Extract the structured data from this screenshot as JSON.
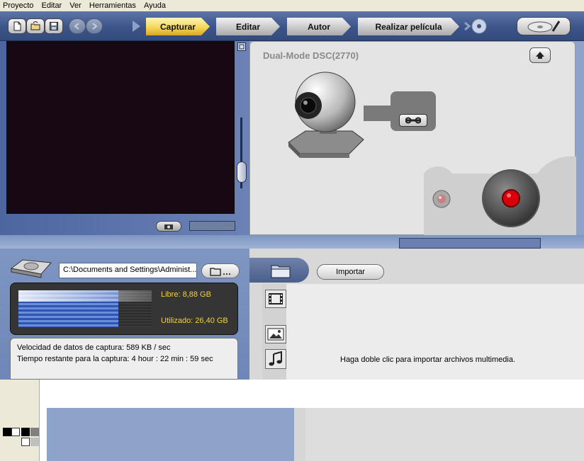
{
  "menu": [
    "Proyecto",
    "Editar",
    "Ver",
    "Herramientas",
    "Ayuda"
  ],
  "toolbar": {
    "file_icons": [
      "new-project-icon",
      "open-project-icon",
      "save-project-icon"
    ],
    "nav_icons": [
      "back-arrow-icon",
      "forward-arrow-icon"
    ],
    "steps": [
      "Capturar",
      "Editar",
      "Autor",
      "Realizar película"
    ],
    "active_step": "Capturar"
  },
  "device": {
    "name": "Dual-Mode DSC(2770)",
    "up_icon": "up-arrow-icon",
    "settings_icon": "wrench-icon",
    "record_icon": "record-icon",
    "indicator_icon": "led-indicator-icon"
  },
  "capture_path": {
    "value": "C:\\Documents and Settings\\Administ...",
    "browse_icon": "folder-browse-icon"
  },
  "disk": {
    "free": "Libre: 8,88 GB",
    "used": "Utilizado: 26,40 GB",
    "used_fraction": 0.75
  },
  "stats": {
    "rate": "Velocidad de datos de captura: 589 KB / sec",
    "remaining": "Tiempo restante para la captura: 4 hour : 22 min : 59 sec"
  },
  "library": {
    "import_label": "Importar",
    "hint": "Haga doble clic para importar archivos multimedia.",
    "tabs": [
      "video-film-icon",
      "image-icon",
      "music-note-icon"
    ]
  },
  "colors": {
    "toolbar": "#3c5488",
    "active_step": "#f6d75a",
    "preview_bg": "#170814",
    "disk_text": "#f4d03f",
    "record_red": "#d9000c"
  }
}
